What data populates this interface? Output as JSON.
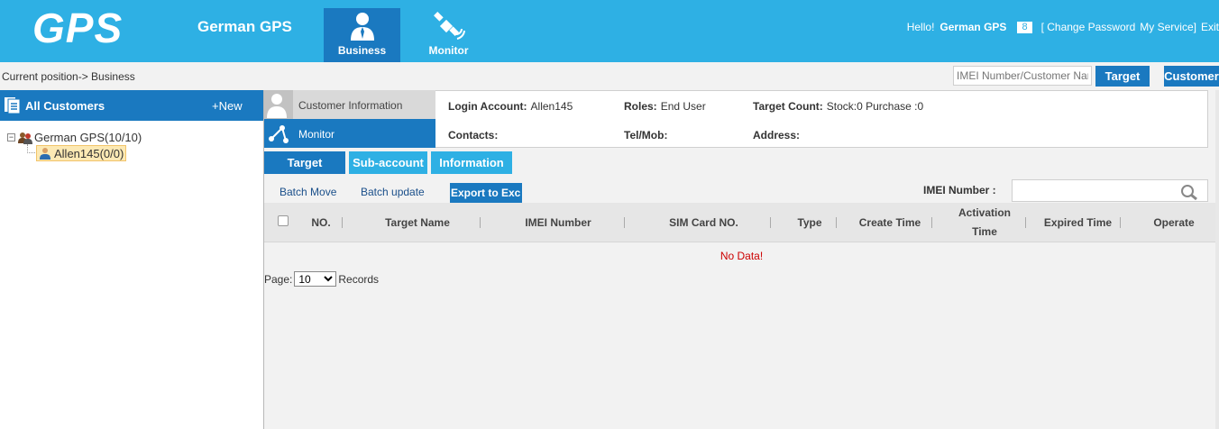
{
  "header": {
    "logo": "GPS",
    "company": "German GPS",
    "nav": [
      {
        "label": "Business",
        "icon": "business-person-icon",
        "active": true
      },
      {
        "label": "Monitor",
        "icon": "satellite-icon",
        "active": false
      }
    ],
    "greeting": "Hello!",
    "username": "German GPS",
    "message_count": "8",
    "change_password": "[ Change Password",
    "my_service": "My Service]",
    "exit": "Exit"
  },
  "breadcrumb": {
    "text": "Current position-> Business",
    "search_placeholder": "IMEI Number/Customer Nam",
    "target_button": "Target",
    "customer_button": "Customer"
  },
  "sidebar": {
    "title": "All Customers",
    "new_button": "+New",
    "tree": {
      "root": "German GPS(10/10)",
      "child": "Allen145(0/0)"
    }
  },
  "info_panel": {
    "tabs": [
      {
        "label": "Customer Information",
        "icon": "user-silhouette-icon"
      },
      {
        "label": "Monitor",
        "icon": "share-nodes-icon"
      }
    ],
    "login_account_label": "Login Account:",
    "login_account_value": "Allen145",
    "roles_label": "Roles:",
    "roles_value": "End User",
    "target_count_label": "Target Count:",
    "target_count_value": "Stock:0 Purchase :0",
    "contacts_label": "Contacts:",
    "tel_label": "Tel/Mob:",
    "address_label": "Address:"
  },
  "subtabs": [
    "Target",
    "Sub-account",
    "Information"
  ],
  "toolbar": {
    "batch_move": "Batch Move",
    "batch_update": "Batch update",
    "export": "Export to Exc",
    "imei_label": "IMEI Number :",
    "imei_value": ""
  },
  "table": {
    "columns": [
      "NO.",
      "Target Name",
      "IMEI Number",
      "SIM Card NO.",
      "Type",
      "Create Time",
      "Activation\nTime",
      "Expired Time",
      "Operate"
    ],
    "empty_text": "No Data!"
  },
  "pager": {
    "page_label": "Page:",
    "page_size": "10",
    "records_label": "Records"
  },
  "colors": {
    "header_bg": "#2eb0e4",
    "accent_dark": "#1a79c0",
    "no_data": "#cc0000"
  }
}
